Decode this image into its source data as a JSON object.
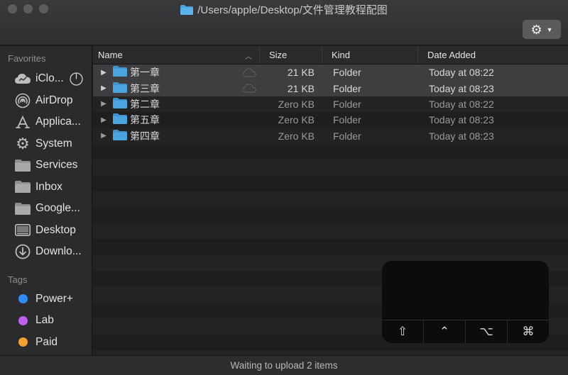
{
  "window": {
    "title": "/Users/apple/Desktop/文件管理教程配图"
  },
  "toolbar": {
    "action_icon": "gear-icon"
  },
  "sidebar": {
    "favorites_header": "Favorites",
    "favorites": [
      {
        "label": "iClo...",
        "icon": "icloud-icon"
      },
      {
        "label": "AirDrop",
        "icon": "airdrop-icon"
      },
      {
        "label": "Applica...",
        "icon": "applications-icon"
      },
      {
        "label": "System",
        "icon": "gear-icon"
      },
      {
        "label": "Services",
        "icon": "folder-icon"
      },
      {
        "label": "Inbox",
        "icon": "folder-icon"
      },
      {
        "label": "Google...",
        "icon": "folder-icon"
      },
      {
        "label": "Desktop",
        "icon": "desktop-icon"
      },
      {
        "label": "Downlo...",
        "icon": "downloads-icon"
      }
    ],
    "tags_header": "Tags",
    "tags": [
      {
        "label": "Power+",
        "color": "#2f8cf5"
      },
      {
        "label": "Lab",
        "color": "#c060f0"
      },
      {
        "label": "Paid",
        "color": "#f5a030"
      }
    ]
  },
  "columns": {
    "name": "Name",
    "size": "Size",
    "kind": "Kind",
    "date": "Date Added"
  },
  "files": [
    {
      "name": "第一章",
      "size": "21 KB",
      "kind": "Folder",
      "date": "Today at 08:22",
      "selected": true,
      "uploading": true
    },
    {
      "name": "第三章",
      "size": "21 KB",
      "kind": "Folder",
      "date": "Today at 08:23",
      "selected": true,
      "uploading": true
    },
    {
      "name": "第二章",
      "size": "Zero KB",
      "kind": "Folder",
      "date": "Today at 08:22",
      "selected": false,
      "uploading": false
    },
    {
      "name": "第五章",
      "size": "Zero KB",
      "kind": "Folder",
      "date": "Today at 08:23",
      "selected": false,
      "uploading": false
    },
    {
      "name": "第四章",
      "size": "Zero KB",
      "kind": "Folder",
      "date": "Today at 08:23",
      "selected": false,
      "uploading": false
    }
  ],
  "keyboard_overlay": {
    "keys": [
      "⇧",
      "⌃",
      "⌥",
      "⌘"
    ]
  },
  "status": {
    "text": "Waiting to upload 2 items"
  },
  "colors": {
    "folder_blue": "#4aa4e0",
    "selection": "#3e3e40"
  }
}
